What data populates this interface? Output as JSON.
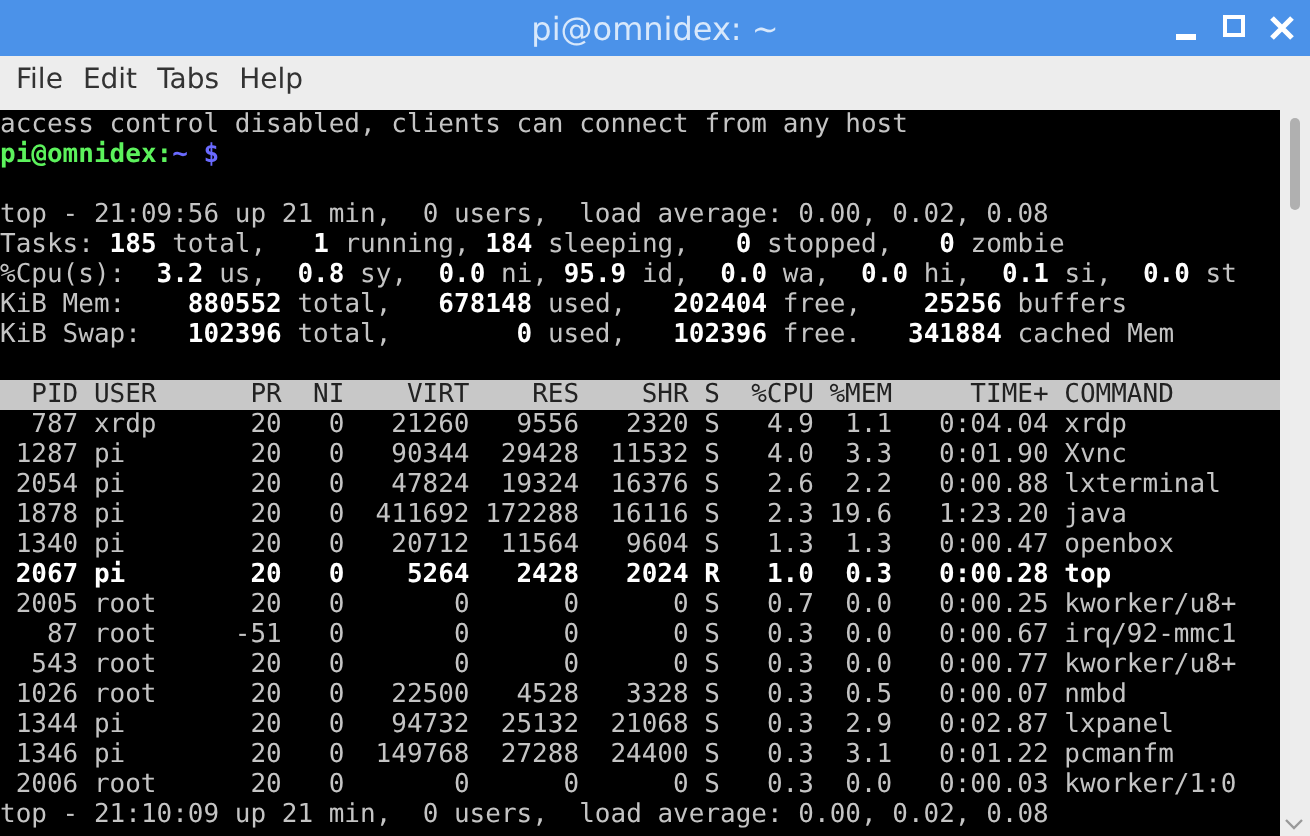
{
  "window": {
    "title": "pi@omnidex: ~"
  },
  "menu": [
    "File",
    "Edit",
    "Tabs",
    "Help"
  ],
  "terminal": {
    "lines_before": [
      "access control disabled, clients can connect from any host"
    ],
    "prompt": {
      "user_host": "pi@omnidex:",
      "path": "~ $"
    },
    "summary": [
      "top - 21:09:56 up 21 min,  0 users,  load average: 0.00, 0.02, 0.08",
      "Tasks: **185** total,   **1** running, **184** sleeping,   **0** stopped,   **0** zombie",
      "%Cpu(s):  **3.2** us,  **0.8** sy,  **0.0** ni, **95.9** id,  **0.0** wa,  **0.0** hi,  **0.1** si,  **0.0** st",
      "KiB Mem:    **880552** total,   **678148** used,   **202404** free,    **25256** buffers",
      "KiB Swap:   **102396** total,        **0** used,   **102396** free.   **341884** cached Mem"
    ],
    "table": {
      "columns": [
        "PID",
        "USER",
        "PR",
        "NI",
        "VIRT",
        "RES",
        "SHR",
        "S",
        "%CPU",
        "%MEM",
        "TIME+",
        "COMMAND"
      ],
      "rows": [
        {
          "cells": [
            "787",
            "xrdp",
            "20",
            "0",
            "21260",
            "9556",
            "2320",
            "S",
            "4.9",
            "1.1",
            "0:04.04",
            "xrdp"
          ],
          "highlighted": false
        },
        {
          "cells": [
            "1287",
            "pi",
            "20",
            "0",
            "90344",
            "29428",
            "11532",
            "S",
            "4.0",
            "3.3",
            "0:01.90",
            "Xvnc"
          ],
          "highlighted": false
        },
        {
          "cells": [
            "2054",
            "pi",
            "20",
            "0",
            "47824",
            "19324",
            "16376",
            "S",
            "2.6",
            "2.2",
            "0:00.88",
            "lxterminal"
          ],
          "highlighted": false
        },
        {
          "cells": [
            "1878",
            "pi",
            "20",
            "0",
            "411692",
            "172288",
            "16116",
            "S",
            "2.3",
            "19.6",
            "1:23.20",
            "java"
          ],
          "highlighted": false
        },
        {
          "cells": [
            "1340",
            "pi",
            "20",
            "0",
            "20712",
            "11564",
            "9604",
            "S",
            "1.3",
            "1.3",
            "0:00.47",
            "openbox"
          ],
          "highlighted": false
        },
        {
          "cells": [
            "2067",
            "pi",
            "20",
            "0",
            "5264",
            "2428",
            "2024",
            "R",
            "1.0",
            "0.3",
            "0:00.28",
            "top"
          ],
          "highlighted": true
        },
        {
          "cells": [
            "2005",
            "root",
            "20",
            "0",
            "0",
            "0",
            "0",
            "S",
            "0.7",
            "0.0",
            "0:00.25",
            "kworker/u8+"
          ],
          "highlighted": false
        },
        {
          "cells": [
            "87",
            "root",
            "-51",
            "0",
            "0",
            "0",
            "0",
            "S",
            "0.3",
            "0.0",
            "0:00.67",
            "irq/92-mmc1"
          ],
          "highlighted": false
        },
        {
          "cells": [
            "543",
            "root",
            "20",
            "0",
            "0",
            "0",
            "0",
            "S",
            "0.3",
            "0.0",
            "0:00.77",
            "kworker/u8+"
          ],
          "highlighted": false
        },
        {
          "cells": [
            "1026",
            "root",
            "20",
            "0",
            "22500",
            "4528",
            "3328",
            "S",
            "0.3",
            "0.5",
            "0:00.07",
            "nmbd"
          ],
          "highlighted": false
        },
        {
          "cells": [
            "1344",
            "pi",
            "20",
            "0",
            "94732",
            "25132",
            "21068",
            "S",
            "0.3",
            "2.9",
            "0:02.87",
            "lxpanel"
          ],
          "highlighted": false
        },
        {
          "cells": [
            "1346",
            "pi",
            "20",
            "0",
            "149768",
            "27288",
            "24400",
            "S",
            "0.3",
            "3.1",
            "0:01.22",
            "pcmanfm"
          ],
          "highlighted": false
        },
        {
          "cells": [
            "2006",
            "root",
            "20",
            "0",
            "0",
            "0",
            "0",
            "S",
            "0.3",
            "0.0",
            "0:00.03",
            "kworker/1:0"
          ],
          "highlighted": false
        }
      ]
    },
    "lines_after": [
      "top - 21:10:09 up 21 min,  0 users,  load average: 0.00, 0.02, 0.08"
    ]
  }
}
